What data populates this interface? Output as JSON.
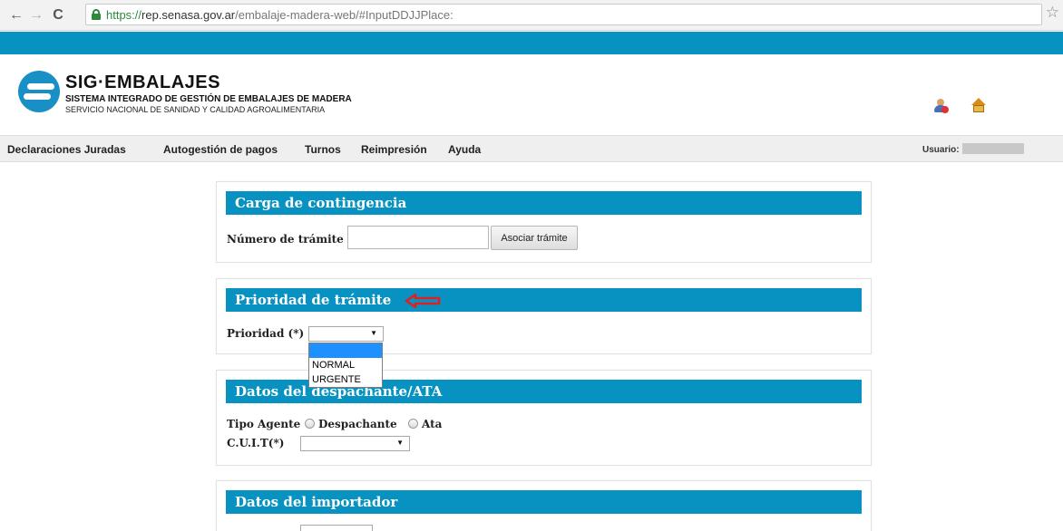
{
  "browser": {
    "url_scheme": "https://",
    "url_host": "rep.senasa.gov.ar",
    "url_path": "/embalaje-madera-web/#InputDDJJPlace:",
    "back_icon": "←",
    "forward_icon": "→",
    "reload_icon": "C",
    "star_icon": "☆"
  },
  "header": {
    "title": "SIG·EMBALAJES",
    "subtitle1": "SISTEMA INTEGRADO DE GESTIÓN DE EMBALAJES DE MADERA",
    "subtitle2": "SERVICIO NACIONAL DE SANIDAD Y CALIDAD AGROALIMENTARIA"
  },
  "menu": {
    "items": [
      "Declaraciones Juradas",
      "Autogestión de pagos",
      "Turnos",
      "Reimpresión",
      "Ayuda"
    ],
    "usuario_label": "Usuario:",
    "usuario_value": ""
  },
  "contingencia": {
    "title": "Carga de contingencia",
    "numero_label": "Número de trámite",
    "numero_value": "",
    "asociar_label": "Asociar trámite"
  },
  "prioridad": {
    "title": "Prioridad de trámite",
    "label": "Prioridad (*)",
    "selected": "",
    "options": [
      "",
      "NORMAL",
      "URGENTE"
    ]
  },
  "despachante": {
    "title": "Datos del despachante/ATA",
    "tipo_label": "Tipo Agente",
    "option_despachante": "Despachante",
    "option_ata": "Ata",
    "cuit_label": "C.U.I.T(*)",
    "cuit_selected": ""
  },
  "importador": {
    "title": "Datos del importador"
  },
  "colors": {
    "accent": "#0892c2",
    "annotation": "#e02020"
  }
}
